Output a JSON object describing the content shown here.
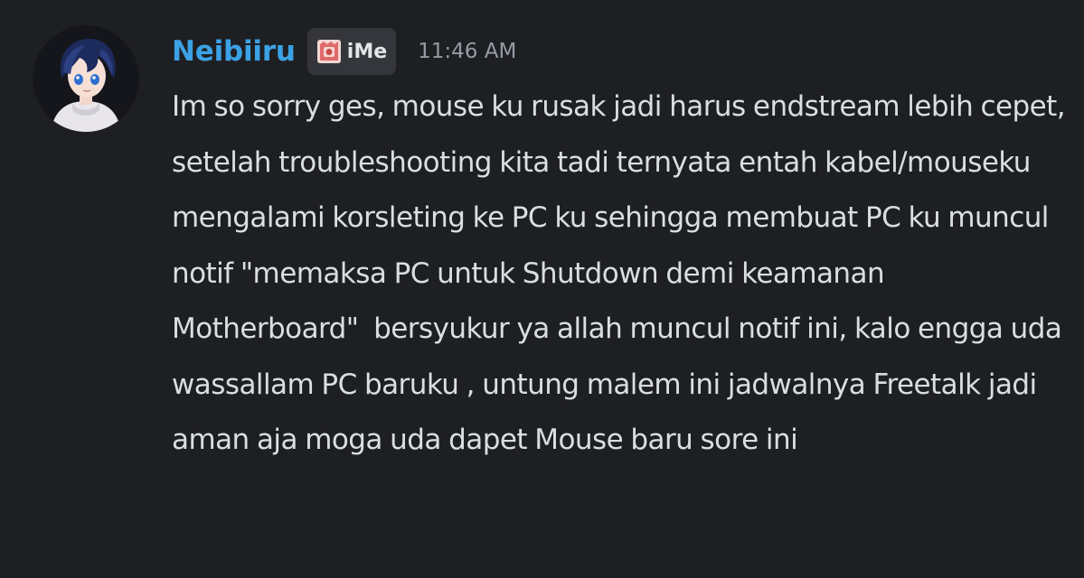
{
  "message": {
    "author": {
      "username": "Neibiiru",
      "username_color": "#3ba2e6",
      "avatar_icon": "anime-character-avatar"
    },
    "tag": {
      "icon": "clan-badge-icon",
      "text": "iMe"
    },
    "timestamp": "11:46 AM",
    "content": "Im so sorry ges, mouse ku rusak jadi harus endstream lebih cepet, setelah troubleshooting kita tadi ternyata entah kabel/mouseku mengalami korsleting ke PC ku sehingga membuat PC ku muncul notif \"memaksa PC untuk Shutdown demi keamanan Motherboard\"  bersyukur ya allah muncul notif ini, kalo engga uda wassallam PC baruku , untung malem ini jadwalnya Freetalk jadi aman aja moga uda dapet Mouse baru sore ini"
  },
  "theme": {
    "background": "#1e1f22",
    "text": "#dbdee1",
    "muted": "#949ba4",
    "tag_bg": "#34363b"
  }
}
